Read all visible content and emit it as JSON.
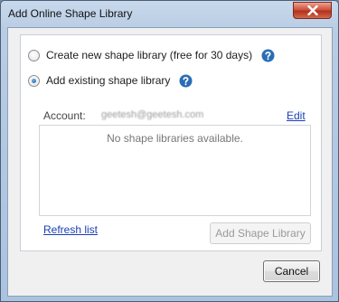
{
  "window": {
    "title": "Add Online Shape Library"
  },
  "options": {
    "create_new": {
      "label": "Create new shape library (free for 30 days)",
      "selected": false
    },
    "add_existing": {
      "label": "Add existing shape library",
      "selected": true
    }
  },
  "account": {
    "label": "Account:",
    "value": "geetesh@geetesh.com",
    "edit_label": "Edit"
  },
  "library_list": {
    "empty_text": "No shape libraries available.",
    "items": []
  },
  "actions": {
    "refresh_label": "Refresh list",
    "add_label": "Add Shape Library",
    "add_enabled": false,
    "cancel_label": "Cancel"
  },
  "colors": {
    "help_icon": "#2a6db5",
    "link": "#1a3fb7",
    "close_button": "#c94a35"
  },
  "icons": {
    "help": "question-mark-circle",
    "close": "x"
  }
}
